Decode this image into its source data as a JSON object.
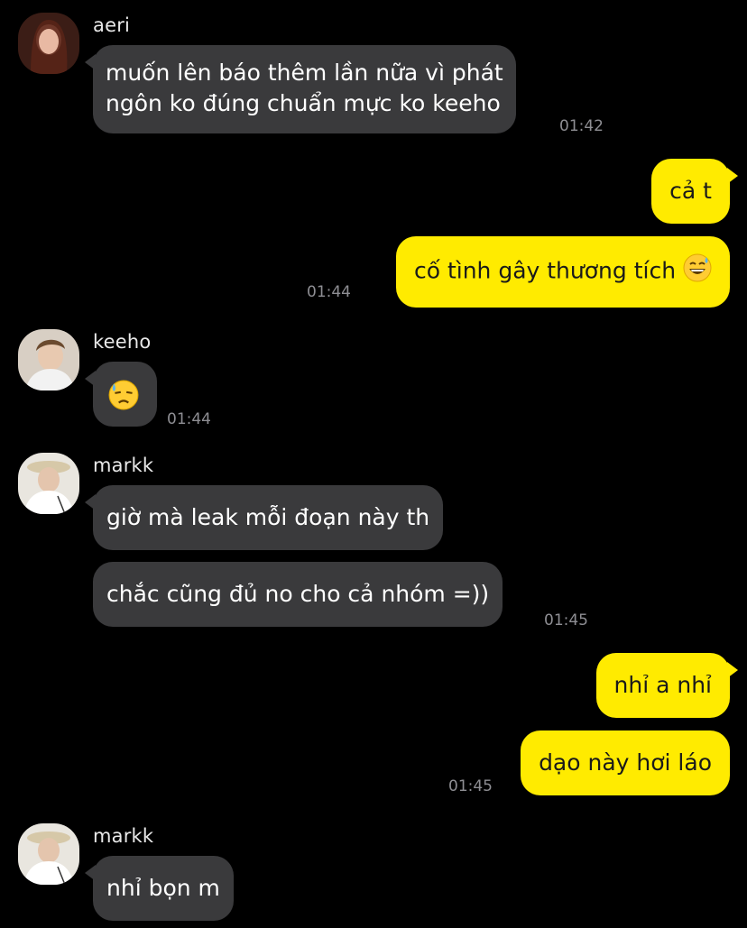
{
  "messages": [
    {
      "sender": "aeri",
      "line1": "muốn lên báo thêm lần nữa vì phát",
      "line2": "ngôn ko đúng chuẩn mực ko keeho",
      "time": "01:42"
    },
    {
      "text": "cả t"
    },
    {
      "text": "cố tình gây thương tích",
      "time": "01:44"
    },
    {
      "sender": "keeho",
      "time": "01:44"
    },
    {
      "sender": "markk",
      "text1": "giờ mà leak mỗi đoạn này th",
      "text2": "chắc cũng đủ no cho cả nhóm =))",
      "time": "01:45"
    },
    {
      "text": "nhỉ a nhỉ"
    },
    {
      "text": "dạo này hơi láo",
      "time": "01:45"
    },
    {
      "sender": "markk",
      "text": "nhỉ bọn m"
    }
  ],
  "icons": {
    "grin_sweat": "grinning-sweat-emoji",
    "downcast_sweat": "downcast-sweat-emoji"
  },
  "colors": {
    "background": "#000000",
    "incoming": "#3a3a3c",
    "outgoing": "#ffeb00",
    "timestamp": "#8e8e93"
  }
}
